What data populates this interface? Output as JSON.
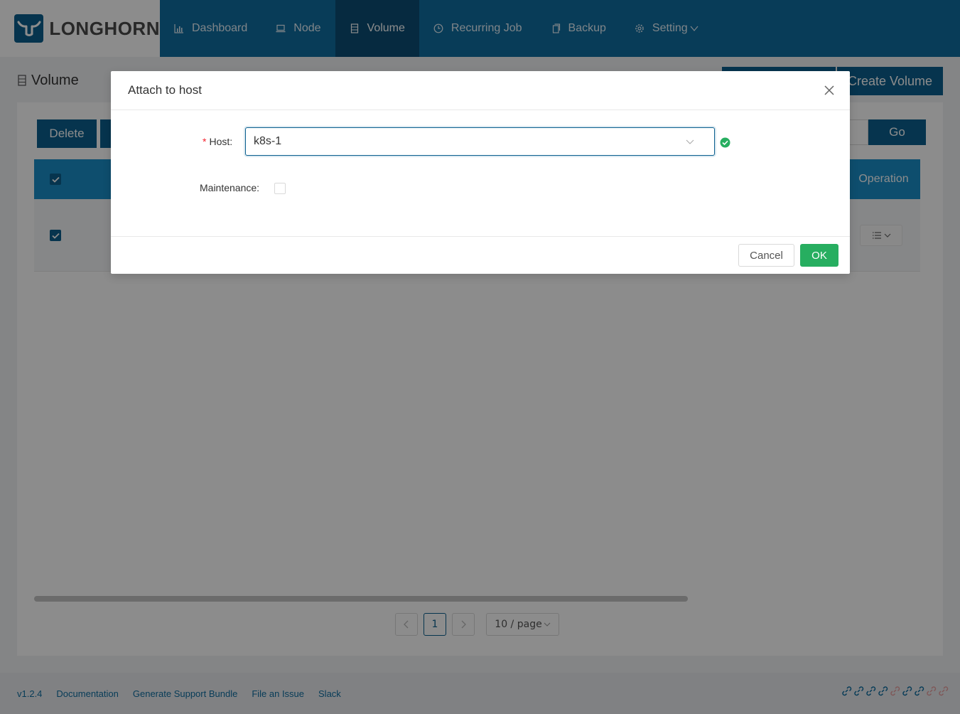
{
  "brand": {
    "name": "LONGHORN"
  },
  "nav": {
    "items": [
      {
        "label": "Dashboard",
        "icon": "bar-chart-icon"
      },
      {
        "label": "Node",
        "icon": "laptop-icon"
      },
      {
        "label": "Volume",
        "icon": "database-icon",
        "active": true
      },
      {
        "label": "Recurring Job",
        "icon": "clock-icon"
      },
      {
        "label": "Backup",
        "icon": "copy-icon"
      },
      {
        "label": "Setting",
        "icon": "gear-icon",
        "dropdown": true
      }
    ]
  },
  "page": {
    "title": "Volume",
    "create_volume_label": "Create Volume",
    "delete_label": "Delete",
    "go_label": "Go"
  },
  "table": {
    "operation_header": "Operation"
  },
  "pagination": {
    "current_page": "1",
    "page_size": "10 / page"
  },
  "footer": {
    "version": "v1.2.4",
    "documentation": "Documentation",
    "support_bundle": "Generate Support Bundle",
    "file_issue": "File an Issue",
    "slack": "Slack"
  },
  "modal": {
    "title": "Attach to host",
    "host_label": "Host:",
    "host_value": "k8s-1",
    "maintenance_label": "Maintenance:",
    "cancel_label": "Cancel",
    "ok_label": "OK"
  },
  "colors": {
    "primary": "#0f6ea1",
    "primary_dark": "#0b5f8e",
    "success": "#27ae60"
  }
}
